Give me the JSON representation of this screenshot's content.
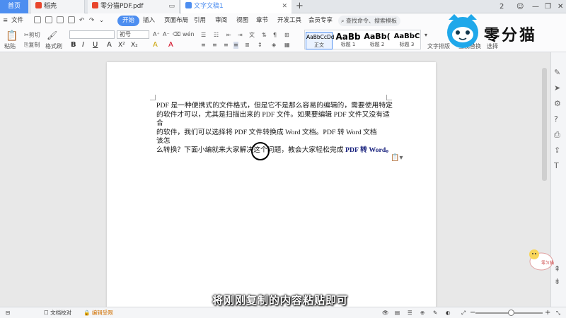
{
  "tabs": {
    "home": "首页",
    "daoke": "稻壳",
    "pdf": "零分猫PDF.pdf",
    "doc": "文字文稿1",
    "new_tab": "+"
  },
  "window": {
    "badge": "2",
    "minimize": "—",
    "restore": "❐",
    "close": "✕"
  },
  "menu": {
    "file": "文件",
    "items": [
      "开始",
      "插入",
      "页面布局",
      "引用",
      "审阅",
      "视图",
      "章节",
      "开发工具",
      "会员专享"
    ],
    "search_placeholder": "查找命令、搜索模板"
  },
  "toolbar": {
    "paste": "粘贴",
    "cut": "剪切",
    "copy": "复制",
    "format_painter": "格式刷",
    "font_name": "",
    "font_size": "初号",
    "format_buttons": [
      "B",
      "I",
      "U",
      "A",
      "X²",
      "X₂",
      "A",
      "A"
    ],
    "text_layout": "文字排版",
    "find_replace": "查找替换",
    "select": "选择"
  },
  "styles": [
    {
      "preview": "AaBbCcDd",
      "label": "正文"
    },
    {
      "preview": "AaBb",
      "label": "标题 1"
    },
    {
      "preview": "AaBb(",
      "label": "标题 2"
    },
    {
      "preview": "AaBbC",
      "label": "标题 3"
    }
  ],
  "brand": {
    "name": "零分猫"
  },
  "document": {
    "lines": [
      "PDF 是一种便携式的文件格式，但是它不是那么容易的编辑的，需要使用特定",
      "的软件才可以，尤其是扫描出来的 PDF 文件。如果要编辑 PDF 文件又没有适",
      "合",
      "的软件，我们可以选择将 PDF 文件转换成 Word 文档。PDF 转 Word 文档",
      "该怎"
    ],
    "last_line_plain": "么转换？下面小编就来大家解决这个问题，教会大家轻松完成 ",
    "last_line_highlight": "PDF 转 Word。"
  },
  "caption": "将刚刚复制的内容粘贴即可",
  "status": {
    "proofread": "文档校对",
    "edit_limit": "编辑受限",
    "zoom_minus": "−",
    "zoom_plus": "+"
  },
  "mascot": {
    "label": "零ㄉ猫"
  },
  "colors": {
    "accent": "#4d8ef0",
    "highlight_text": "#1a237e",
    "brand_dark": "#111111"
  }
}
